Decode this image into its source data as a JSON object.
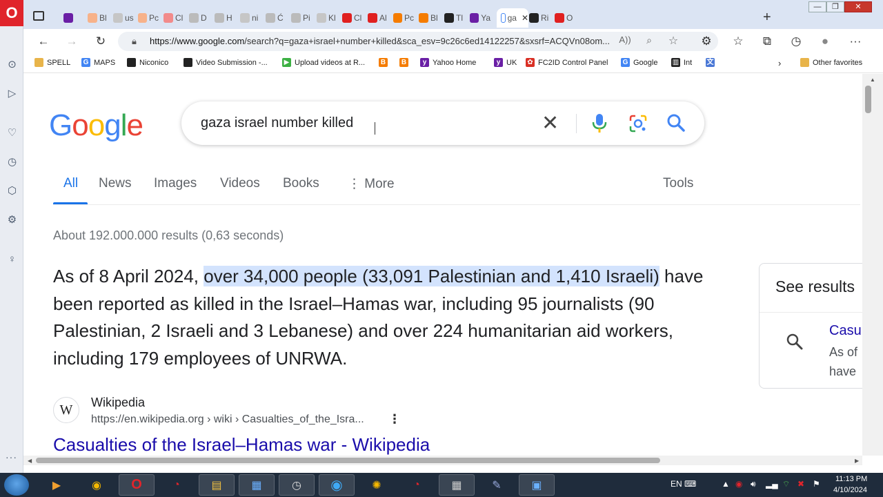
{
  "browser": {
    "url_host": "https://www.google.com",
    "url_rest": "/search?q=gaza+israel+number+killed&sca_esv=9c26c6ed14122257&sxsrf=ACQVn08om...",
    "tabs": [
      {
        "label": "",
        "icon": "tab-actions-icon"
      },
      {
        "label": "",
        "color": "#6a1fa5",
        "icon": "yahoo-icon"
      },
      {
        "label": "Bl",
        "color": "#f7b28a",
        "icon": "blogger-icon"
      },
      {
        "label": "us",
        "color": "#c6c6c6",
        "icon": "google-icon"
      },
      {
        "label": "Pc",
        "color": "#f7b28a",
        "icon": "blogger-icon"
      },
      {
        "label": "Cl",
        "color": "#f28b8b",
        "icon": "youtube-icon"
      },
      {
        "label": "D",
        "color": "#bbb",
        "icon": "shield-icon"
      },
      {
        "label": "H",
        "color": "#bbb",
        "icon": "history-icon"
      },
      {
        "label": "ni",
        "color": "#c6c6c6",
        "icon": "google-icon"
      },
      {
        "label": "Ć",
        "color": "#bbb",
        "icon": "shield-icon"
      },
      {
        "label": "Pi",
        "color": "#bbb",
        "icon": "pin-icon"
      },
      {
        "label": "Kl",
        "color": "#c6c6c6",
        "icon": "google-icon"
      },
      {
        "label": "Cl",
        "color": "#e02020",
        "icon": "youtube-icon"
      },
      {
        "label": "Al",
        "color": "#e02020",
        "icon": "youtube-icon"
      },
      {
        "label": "Pc",
        "color": "#f57c00",
        "icon": "blogger-icon"
      },
      {
        "label": "Bl",
        "color": "#f57c00",
        "icon": "blogger-icon"
      },
      {
        "label": "Tl",
        "color": "#222",
        "icon": "atlantic-icon"
      },
      {
        "label": "Ya",
        "color": "#6a1fa5",
        "icon": "yahoo-icon"
      },
      {
        "label": "ga",
        "color": "#fff",
        "icon": "google-icon"
      },
      {
        "label": "Ri",
        "color": "#222",
        "icon": "wikipedia-icon"
      },
      {
        "label": "O",
        "color": "#e02020",
        "icon": "youtube-icon"
      }
    ],
    "active_tab_close": "✕",
    "new_tab": "+",
    "window_buttons": {
      "minimize": "—",
      "restore": "❐",
      "close": "✕"
    }
  },
  "bookmarks": [
    {
      "label": "SPELL",
      "color": "#e8b44a",
      "icon": "folder-icon",
      "glyph": ""
    },
    {
      "label": "MAPS",
      "color": "#4285f4",
      "icon": "google-icon",
      "glyph": "G"
    },
    {
      "label": "Niconico",
      "color": "#222",
      "icon": "niconico-icon",
      "glyph": ""
    },
    {
      "label": "Video Submission -...",
      "color": "#222",
      "icon": "niconico-icon",
      "glyph": ""
    },
    {
      "label": "Upload videos at R...",
      "color": "#3cb043",
      "icon": "rumble-icon",
      "glyph": "▶"
    },
    {
      "label": "",
      "color": "#f57c00",
      "icon": "blogger-icon",
      "glyph": "B"
    },
    {
      "label": "",
      "color": "#f57c00",
      "icon": "blogger-icon",
      "glyph": "B"
    },
    {
      "label": "Yahoo Home",
      "color": "#6a1fa5",
      "icon": "yahoo-icon",
      "glyph": "y"
    },
    {
      "label": "UK",
      "color": "#6a1fa5",
      "icon": "yahoo-icon",
      "glyph": "y"
    },
    {
      "label": "FC2ID Control Panel",
      "color": "#d93025",
      "icon": "fc2-icon",
      "glyph": "✿"
    },
    {
      "label": "Google",
      "color": "#4285f4",
      "icon": "google-icon",
      "glyph": "G"
    },
    {
      "label": "Int",
      "color": "#222",
      "icon": "archive-icon",
      "glyph": "▥"
    },
    {
      "label": "",
      "color": "#4a78d6",
      "icon": "translate-icon",
      "glyph": "文"
    }
  ],
  "other_favorites": "Other favorites",
  "search": {
    "logo": [
      {
        "ch": "G",
        "color": "#4285F4"
      },
      {
        "ch": "o",
        "color": "#EA4335"
      },
      {
        "ch": "o",
        "color": "#FBBC05"
      },
      {
        "ch": "g",
        "color": "#4285F4"
      },
      {
        "ch": "l",
        "color": "#34A853"
      },
      {
        "ch": "e",
        "color": "#EA4335"
      }
    ],
    "query": "gaza israel number killed",
    "clear": "✕"
  },
  "tabs": [
    {
      "label": "All",
      "active": true
    },
    {
      "label": "News"
    },
    {
      "label": "Images"
    },
    {
      "label": "Videos"
    },
    {
      "label": "Books"
    },
    {
      "label": "More"
    }
  ],
  "more_dots": "⋮",
  "tools": "Tools",
  "stats": "About 192.000.000 results (0,63 seconds)",
  "snippet": {
    "before": "As of 8 April 2024, ",
    "highlight": "over 34,000 people (33,091 Palestinian and 1,410 Israeli)",
    "after": " have been reported as killed in the Israel–Hamas war, including 95 journalists (90 Palestinian, 2 Israeli and 3 Lebanese) and over 224 humanitarian aid workers, including 179 employees of UNRWA."
  },
  "source": {
    "badge": "W",
    "name": "Wikipedia",
    "url": "https://en.wikipedia.org › wiki › Casualties_of_the_Isra...",
    "more": "⋮"
  },
  "result_title": "Casualties of the Israel–Hamas war - Wikipedia",
  "side_card": {
    "title": "See results",
    "link": "Casu",
    "line1": "As of",
    "line2": "have"
  },
  "taskbar": {
    "lang": "EN",
    "time": "11:13 PM",
    "date": "4/10/2024"
  }
}
